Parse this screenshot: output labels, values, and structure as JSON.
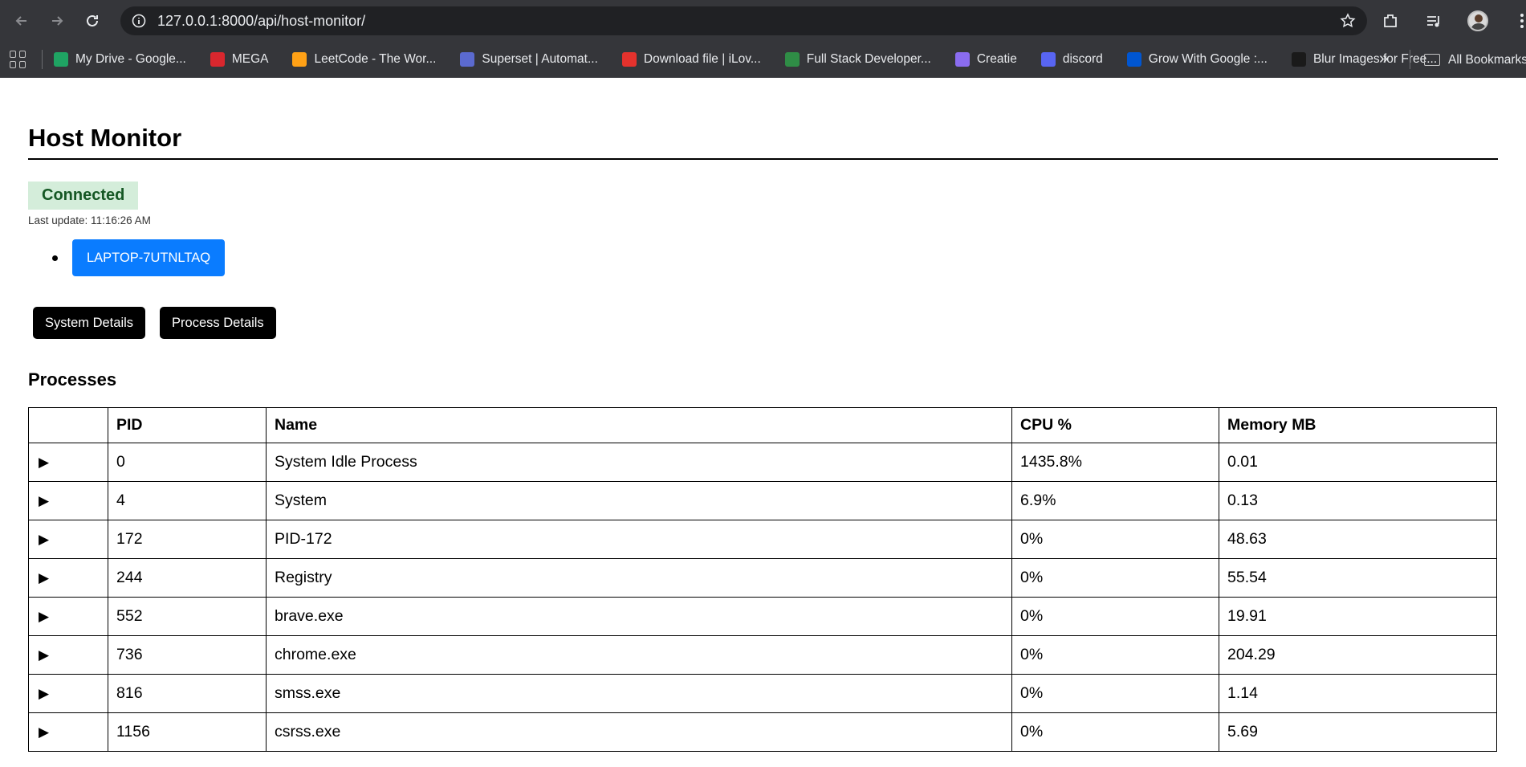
{
  "browser": {
    "url": "127.0.0.1:8000/api/host-monitor/",
    "bookmarks": [
      {
        "label": "My Drive - Google...",
        "icon": "google-drive-icon",
        "color": "#1fa463"
      },
      {
        "label": "MEGA",
        "icon": "mega-icon",
        "color": "#d9272e"
      },
      {
        "label": "LeetCode - The Wor...",
        "icon": "leetcode-icon",
        "color": "#ffa116"
      },
      {
        "label": "Superset | Automat...",
        "icon": "superset-icon",
        "color": "#5b6acf"
      },
      {
        "label": "Download file | iLov...",
        "icon": "ilovepdf-icon",
        "color": "#e5322d"
      },
      {
        "label": "Full Stack Developer...",
        "icon": "geeksforgeeks-icon",
        "color": "#2f8d46"
      },
      {
        "label": "Creatie",
        "icon": "creatie-icon",
        "color": "#8a6cf0"
      },
      {
        "label": "discord",
        "icon": "discord-icon",
        "color": "#5865f2"
      },
      {
        "label": "Grow With Google :...",
        "icon": "coursera-icon",
        "color": "#0056d2"
      },
      {
        "label": "Blur Images for Free...",
        "icon": "adobe-express-icon",
        "color": "#1a1a1a"
      }
    ],
    "all_bookmarks": "All Bookmarks"
  },
  "page": {
    "title": "Host Monitor",
    "status": "Connected",
    "last_update": "Last update: 11:16:26 AM",
    "hosts": [
      "LAPTOP-7UTNLTAQ"
    ],
    "buttons": {
      "system": "System Details",
      "process": "Process Details"
    },
    "processes_heading": "Processes"
  },
  "table": {
    "headers": [
      "",
      "PID",
      "Name",
      "CPU %",
      "Memory MB"
    ],
    "rows": [
      {
        "pid": "0",
        "name": "System Idle Process",
        "cpu": "1435.8%",
        "mem": "0.01"
      },
      {
        "pid": "4",
        "name": "System",
        "cpu": "6.9%",
        "mem": "0.13"
      },
      {
        "pid": "172",
        "name": "PID-172",
        "cpu": "0%",
        "mem": "48.63"
      },
      {
        "pid": "244",
        "name": "Registry",
        "cpu": "0%",
        "mem": "55.54"
      },
      {
        "pid": "552",
        "name": "brave.exe",
        "cpu": "0%",
        "mem": "19.91"
      },
      {
        "pid": "736",
        "name": "chrome.exe",
        "cpu": "0%",
        "mem": "204.29"
      },
      {
        "pid": "816",
        "name": "smss.exe",
        "cpu": "0%",
        "mem": "1.14"
      },
      {
        "pid": "1156",
        "name": "csrss.exe",
        "cpu": "0%",
        "mem": "5.69"
      }
    ]
  }
}
